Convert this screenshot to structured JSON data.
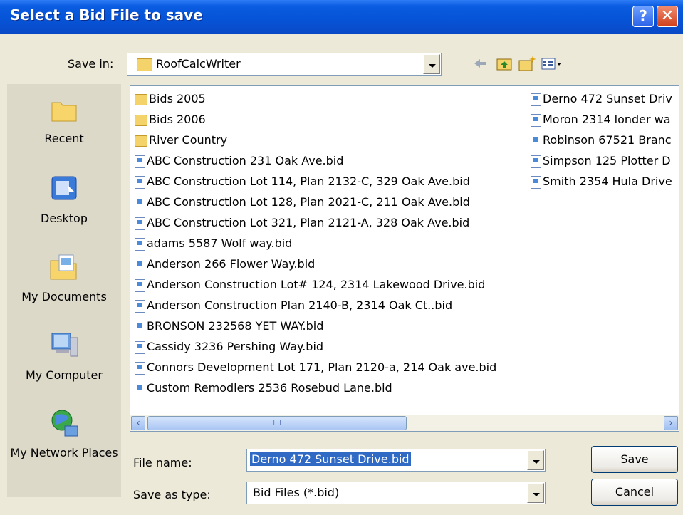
{
  "window": {
    "title": "Select a Bid File to save"
  },
  "toolbar": {
    "save_in_label": "Save in:",
    "save_in_value": "RoofCalcWriter",
    "icons": [
      "back-arrow-icon",
      "up-folder-icon",
      "new-folder-icon",
      "views-menu-icon"
    ]
  },
  "places": [
    {
      "label": "Recent",
      "icon": "recent-folder-icon"
    },
    {
      "label": "Desktop",
      "icon": "desktop-icon"
    },
    {
      "label": "My Documents",
      "icon": "my-documents-icon"
    },
    {
      "label": "My Computer",
      "icon": "my-computer-icon"
    },
    {
      "label": "My Network Places",
      "icon": "network-places-icon"
    }
  ],
  "files": {
    "column1": [
      {
        "name": "Bids 2005",
        "type": "folder"
      },
      {
        "name": "Bids 2006",
        "type": "folder"
      },
      {
        "name": "River Country",
        "type": "folder"
      },
      {
        "name": "ABC Construction 231 Oak Ave.bid",
        "type": "bid"
      },
      {
        "name": "ABC Construction Lot 114, Plan 2132-C, 329 Oak Ave.bid",
        "type": "bid"
      },
      {
        "name": "ABC Construction Lot 128, Plan 2021-C, 211 Oak Ave.bid",
        "type": "bid"
      },
      {
        "name": "ABC Construction Lot 321, Plan 2121-A, 328 Oak Ave.bid",
        "type": "bid"
      },
      {
        "name": "adams 5587 Wolf way.bid",
        "type": "bid"
      },
      {
        "name": "Anderson 266 Flower Way.bid",
        "type": "bid"
      },
      {
        "name": "Anderson Construction Lot# 124, 2314 Lakewood Drive.bid",
        "type": "bid"
      },
      {
        "name": "Anderson Construction Plan 2140-B, 2314 Oak Ct..bid",
        "type": "bid"
      },
      {
        "name": "BRONSON 232568 YET WAY.bid",
        "type": "bid"
      },
      {
        "name": "Cassidy 3236 Pershing Way.bid",
        "type": "bid"
      },
      {
        "name": "Connors Development Lot 171, Plan 2120-a, 214 Oak ave.bid",
        "type": "bid"
      },
      {
        "name": "Custom Remodlers 2536 Rosebud Lane.bid",
        "type": "bid"
      }
    ],
    "column2": [
      {
        "name": "Derno 472 Sunset Driv",
        "type": "bid"
      },
      {
        "name": "Moron 2314 londer wa",
        "type": "bid"
      },
      {
        "name": "Robinson 67521 Branc",
        "type": "bid"
      },
      {
        "name": "Simpson 125 Plotter D",
        "type": "bid"
      },
      {
        "name": "Smith 2354 Hula Drive",
        "type": "bid"
      }
    ]
  },
  "scrollbar": {
    "thumb_grip": "IIII"
  },
  "form": {
    "file_name_label": "File name:",
    "file_name_value": "Derno 472 Sunset Drive.bid",
    "save_type_label": "Save as type:",
    "save_type_value": "Bid Files (*.bid)"
  },
  "buttons": {
    "save": "Save",
    "cancel": "Cancel"
  },
  "colors": {
    "titlebar": "#0654d8",
    "selection": "#316ac5",
    "dialog_bg": "#ece9d8"
  }
}
